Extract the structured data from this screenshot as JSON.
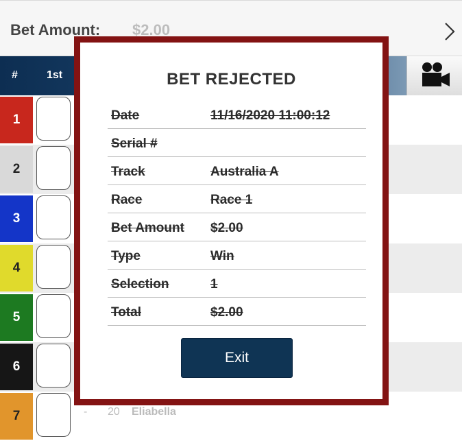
{
  "bet_bar": {
    "label": "Bet Amount:",
    "value": "$2.00",
    "next_icon": "chevron-right-icon"
  },
  "header": {
    "col_num": "#",
    "col_first": "1st",
    "camera_icon": "video-camera-icon"
  },
  "runners": [
    {
      "number": "1",
      "color": "#c8271d",
      "text_color": "#ffffff"
    },
    {
      "number": "2",
      "color": "#d9d9d9",
      "text_color": "#222222"
    },
    {
      "number": "3",
      "color": "#1435c8",
      "text_color": "#ffffff"
    },
    {
      "number": "4",
      "color": "#e0da2c",
      "text_color": "#222222"
    },
    {
      "number": "5",
      "color": "#1d7a21",
      "text_color": "#ffffff"
    },
    {
      "number": "6",
      "color": "#161616",
      "text_color": "#ffffff"
    },
    {
      "number": "7",
      "color": "#e1952c",
      "text_color": "#222222",
      "dash": "-",
      "runner_no": "20",
      "name": "Eliabella"
    }
  ],
  "modal": {
    "title": "BET REJECTED",
    "rows": [
      {
        "key": "Date",
        "value": "11/16/2020 11:00:12"
      },
      {
        "key": "Serial #",
        "value": ""
      },
      {
        "key": "Track",
        "value": "Australia A"
      },
      {
        "key": "Race",
        "value": "Race 1"
      },
      {
        "key": "Bet Amount",
        "value": "$2.00"
      },
      {
        "key": "Type",
        "value": "Win"
      },
      {
        "key": "Selection",
        "value": "1"
      },
      {
        "key": "Total",
        "value": "$2.00"
      }
    ],
    "exit_label": "Exit"
  }
}
